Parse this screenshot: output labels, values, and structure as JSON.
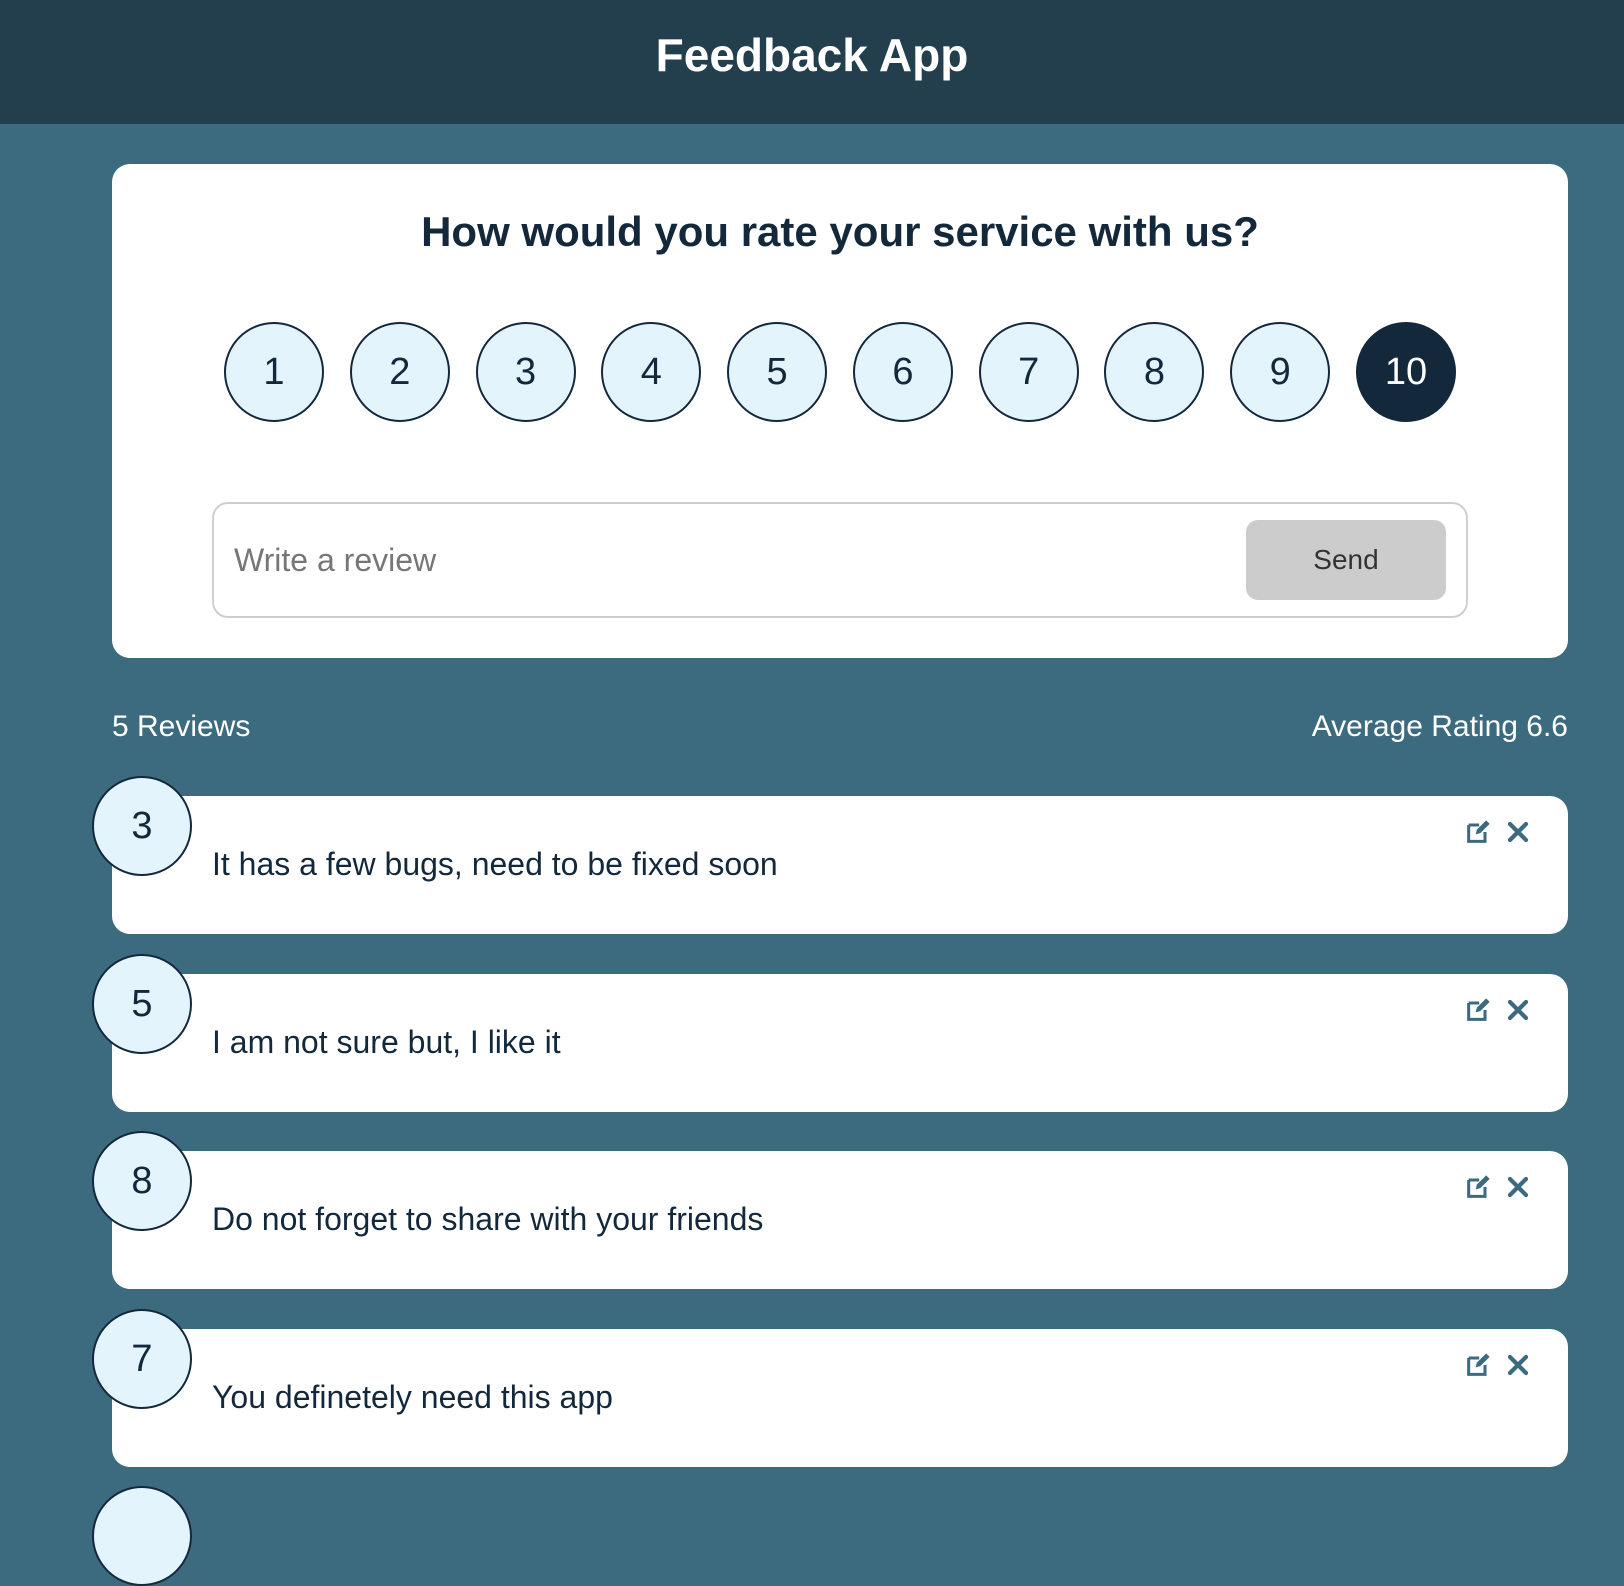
{
  "header": {
    "title": "Feedback App"
  },
  "rating_card": {
    "question": "How would you rate your service with us?",
    "options": [
      "1",
      "2",
      "3",
      "4",
      "5",
      "6",
      "7",
      "8",
      "9",
      "10"
    ],
    "selected": "10",
    "review_input": {
      "placeholder": "Write a review",
      "value": ""
    },
    "send_label": "Send"
  },
  "stats": {
    "count_label": "5 Reviews",
    "average_label": "Average Rating 6.6"
  },
  "reviews": [
    {
      "rating": "3",
      "text": "It has a few bugs, need to be fixed soon"
    },
    {
      "rating": "5",
      "text": "I am not sure but, I like it"
    },
    {
      "rating": "8",
      "text": "Do not forget to share with your friends"
    },
    {
      "rating": "7",
      "text": "You definetely need this app"
    }
  ],
  "icons": {
    "edit": "edit-icon",
    "delete": "close-icon"
  },
  "colors": {
    "background": "#3c6b80",
    "header": "#233f4e",
    "dark": "#14283c",
    "light_circle": "#e3f4fc"
  }
}
